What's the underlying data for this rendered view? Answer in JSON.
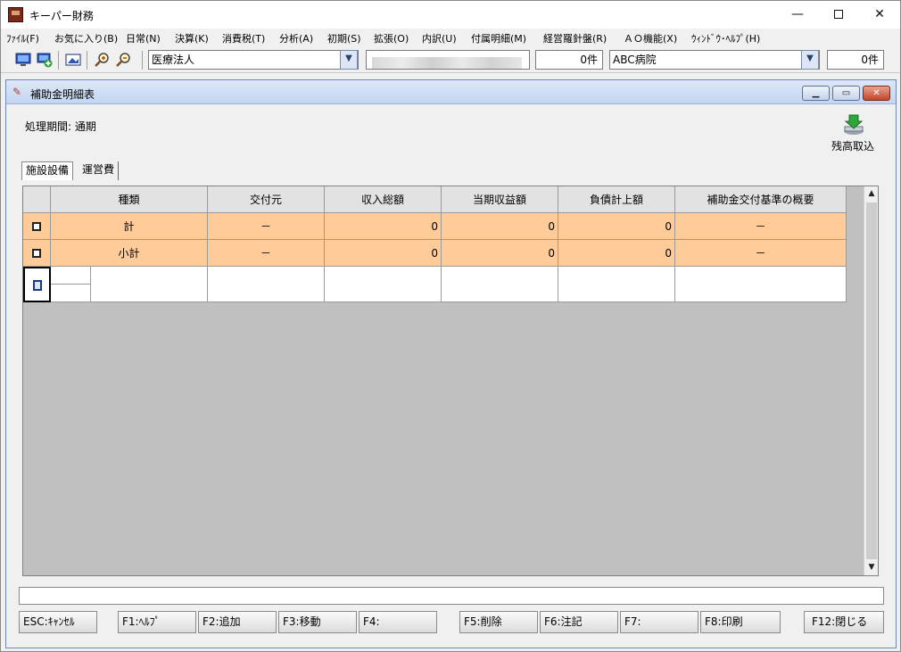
{
  "window": {
    "title": "キーパー財務"
  },
  "menu": [
    "ﾌｧｲﾙ(F)",
    "お気に入り(B)",
    "日常(N)",
    "決算(K)",
    "消費税(T)",
    "分析(A)",
    "初期(S)",
    "拡張(O)",
    "内訳(U)",
    "付属明細(M)",
    "経営羅針盤(R)",
    "ＡＯ機能(X)",
    "ｳｨﾝﾄﾞｳ･ﾍﾙﾌﾟ(H)"
  ],
  "toolbar": {
    "entity_type": "医療法人",
    "count1": "0件",
    "facility": "ABC病院",
    "count2": "0件"
  },
  "child": {
    "title": "補助金明細表",
    "period": "処理期間: 通期",
    "import_label": "残高取込"
  },
  "tabs": [
    "施設設備",
    "運営費"
  ],
  "grid": {
    "headers": [
      "種類",
      "交付元",
      "収入総額",
      "当期収益額",
      "負債計上額",
      "補助金交付基準の概要"
    ],
    "rows": [
      {
        "kind": "計",
        "source": "－",
        "income_total": "0",
        "current_revenue": "0",
        "liability": "0",
        "overview": "－"
      },
      {
        "kind": "小計",
        "source": "－",
        "income_total": "0",
        "current_revenue": "0",
        "liability": "0",
        "overview": "－"
      }
    ]
  },
  "fkeys": [
    "ESC:ｷｬﾝｾﾙ",
    "F1:ﾍﾙﾌﾟ",
    "F2:追加",
    "F3:移動",
    "F4:",
    "F5:削除",
    "F6:注記",
    "F7:",
    "F8:印刷",
    "F12:閉じる"
  ],
  "colors": {
    "row_highlight": "#ffcc99",
    "grid_bg": "#c0c0c0"
  }
}
